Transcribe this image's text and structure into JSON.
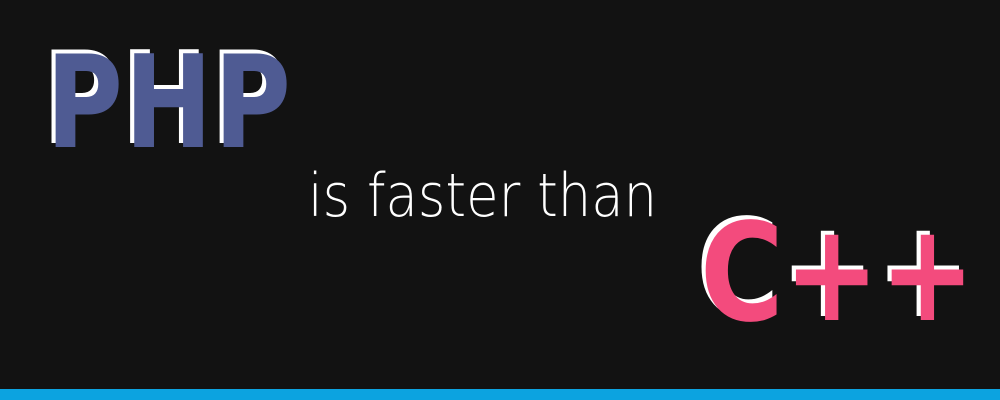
{
  "banner": {
    "title_left": "PHP",
    "middle_text": "is faster than",
    "title_right": "C++"
  },
  "colors": {
    "background": "#121212",
    "php": "#4f5b93",
    "cpp": "#f34b7d",
    "middle_text": "#ffffff",
    "outline": "#ffffff",
    "bottom_bar": "#0ca3e0"
  }
}
